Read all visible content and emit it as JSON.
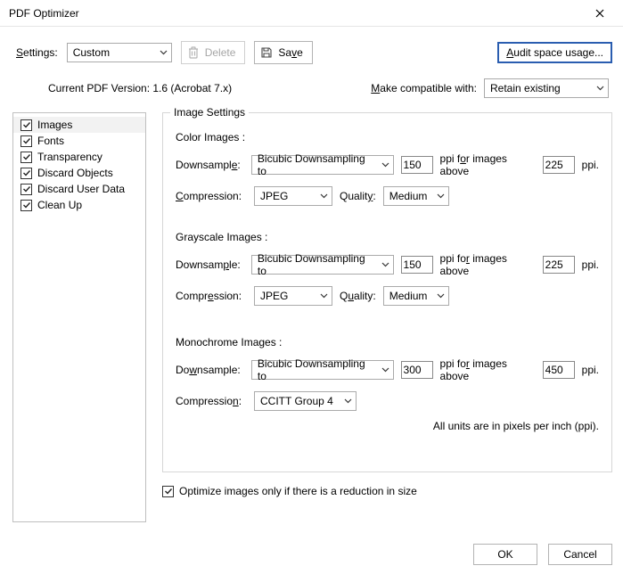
{
  "window": {
    "title": "PDF Optimizer"
  },
  "toolbar": {
    "settings_label": "Settings:",
    "settings_value": "Custom",
    "delete_label": "Delete",
    "save_label": "Save",
    "audit_label": "Audit space usage..."
  },
  "version_line": "Current PDF Version: 1.6 (Acrobat 7.x)",
  "compat": {
    "label": "Make compatible with:",
    "value": "Retain existing"
  },
  "categories": [
    {
      "label": "Images",
      "checked": true,
      "selected": true
    },
    {
      "label": "Fonts",
      "checked": true
    },
    {
      "label": "Transparency",
      "checked": true
    },
    {
      "label": "Discard Objects",
      "checked": true
    },
    {
      "label": "Discard User Data",
      "checked": true
    },
    {
      "label": "Clean Up",
      "checked": true
    }
  ],
  "panel": {
    "title": "Image Settings",
    "color": {
      "title": "Color Images :",
      "downsample_label": "Downsample:",
      "downsample_value": "Bicubic Downsampling to",
      "ppi": "150",
      "ppi_label_left": "ppi for images above",
      "above": "225",
      "ppi_label_right": "ppi.",
      "compression_label": "Compression:",
      "compression_value": "JPEG",
      "quality_label": "Quality:",
      "quality_value": "Medium"
    },
    "gray": {
      "title": "Grayscale Images :",
      "downsample_label": "Downsample:",
      "downsample_value": "Bicubic Downsampling to",
      "ppi": "150",
      "ppi_label_left": "ppi for images above",
      "above": "225",
      "ppi_label_right": "ppi.",
      "compression_label": "Compression:",
      "compression_value": "JPEG",
      "quality_label": "Quality:",
      "quality_value": "Medium"
    },
    "mono": {
      "title": "Monochrome Images :",
      "downsample_label": "Downsample:",
      "downsample_value": "Bicubic Downsampling to",
      "ppi": "300",
      "ppi_label_left": "ppi for images above",
      "above": "450",
      "ppi_label_right": "ppi.",
      "compression_label": "Compression:",
      "compression_value": "CCITT Group 4"
    },
    "footer": "All units are in pixels per inch (ppi)."
  },
  "optimize_checkbox": {
    "checked": true,
    "label": "Optimize images only if there is a reduction in size"
  },
  "buttons": {
    "ok": "OK",
    "cancel": "Cancel"
  }
}
